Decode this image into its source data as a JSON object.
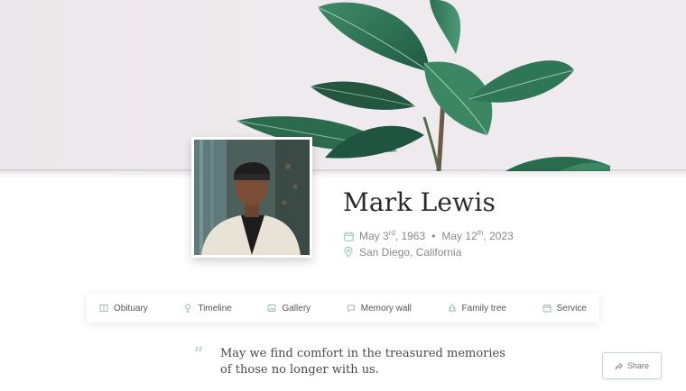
{
  "profile": {
    "name": "Mark Lewis",
    "birth_prefix": "May 3",
    "birth_suffix": "rd",
    "birth_year": ", 1963",
    "separator": "•",
    "death_prefix": "May 12",
    "death_suffix": "th",
    "death_year": ", 2023",
    "location": "San Diego, California"
  },
  "nav": {
    "items": [
      {
        "label": "Obituary",
        "icon": "book-icon"
      },
      {
        "label": "Timeline",
        "icon": "timeline-icon"
      },
      {
        "label": "Gallery",
        "icon": "image-icon"
      },
      {
        "label": "Memory wall",
        "icon": "message-icon"
      },
      {
        "label": "Family tree",
        "icon": "tree-icon"
      },
      {
        "label": "Service",
        "icon": "calendar-icon"
      }
    ]
  },
  "quote": {
    "mark": "“",
    "text": "May we find comfort in the treasured memories of those no longer with us."
  },
  "share": {
    "label": "Share",
    "icon": "share-icon"
  },
  "colors": {
    "accent": "#8ec9af",
    "hero_bg": "#efeaed",
    "text": "#2a2a2a"
  }
}
